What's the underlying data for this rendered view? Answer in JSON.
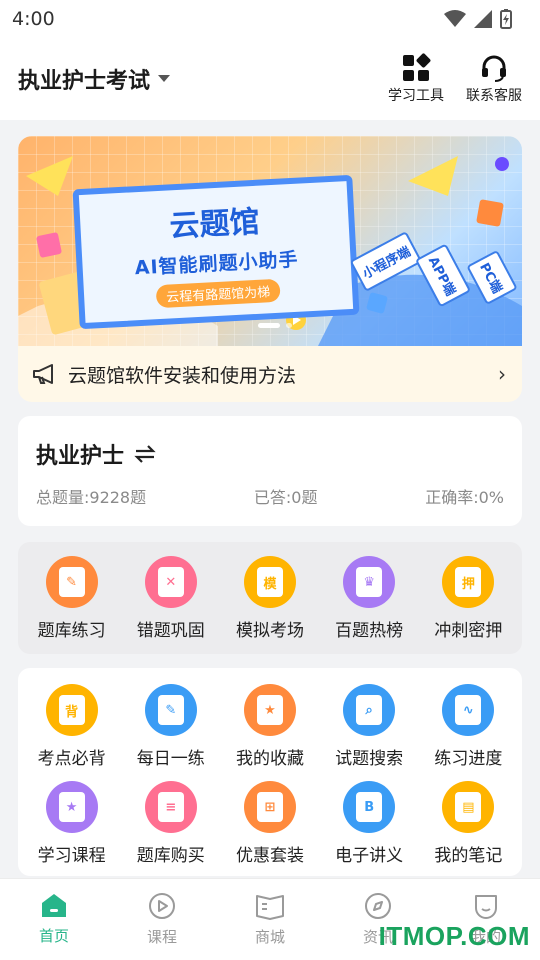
{
  "status": {
    "time": "4:00"
  },
  "header": {
    "title": "执业护士考试",
    "actions": [
      {
        "label": "学习工具",
        "icon": "grid-icon"
      },
      {
        "label": "联系客服",
        "icon": "headset-icon"
      }
    ]
  },
  "banner": {
    "title": "云题馆",
    "subtitle": "AI智能刷题小助手",
    "pill": "云程有路题馆为梯",
    "tags": [
      "小程序端",
      "APP端",
      "PC端"
    ]
  },
  "notice": {
    "text": "云题馆软件安装和使用方法"
  },
  "exam": {
    "name": "执业护士",
    "total": "总题量:9228题",
    "answered": "已答:0题",
    "accuracy": "正确率:0%"
  },
  "grid_main": [
    {
      "label": "题库练习",
      "color": "#ff8a3d",
      "glyph": "✎"
    },
    {
      "label": "错题巩固",
      "color": "#ff6f91",
      "glyph": "✕"
    },
    {
      "label": "模拟考场",
      "color": "#ffb400",
      "glyph": "模"
    },
    {
      "label": "百题热榜",
      "color": "#a77af4",
      "glyph": "♛"
    },
    {
      "label": "冲刺密押",
      "color": "#ffb400",
      "glyph": "押"
    }
  ],
  "grid_tools_row1": [
    {
      "label": "考点必背",
      "color": "#ffb400",
      "glyph": "背"
    },
    {
      "label": "每日一练",
      "color": "#3a9cf5",
      "glyph": "✎"
    },
    {
      "label": "我的收藏",
      "color": "#ff8a3d",
      "glyph": "★"
    },
    {
      "label": "试题搜索",
      "color": "#3a9cf5",
      "glyph": "⌕"
    },
    {
      "label": "练习进度",
      "color": "#3a9cf5",
      "glyph": "∿"
    }
  ],
  "grid_tools_row2": [
    {
      "label": "学习课程",
      "color": "#a77af4",
      "glyph": "★"
    },
    {
      "label": "题库购买",
      "color": "#ff6f91",
      "glyph": "≡"
    },
    {
      "label": "优惠套装",
      "color": "#ff8a3d",
      "glyph": "⊞"
    },
    {
      "label": "电子讲义",
      "color": "#3a9cf5",
      "glyph": "B"
    },
    {
      "label": "我的笔记",
      "color": "#ffb400",
      "glyph": "▤"
    }
  ],
  "nav": [
    {
      "label": "首页",
      "active": true
    },
    {
      "label": "课程",
      "active": false
    },
    {
      "label": "商城",
      "active": false
    },
    {
      "label": "资讯",
      "active": false
    },
    {
      "label": "我的",
      "active": false
    }
  ],
  "watermark": "ITMOP.COM"
}
